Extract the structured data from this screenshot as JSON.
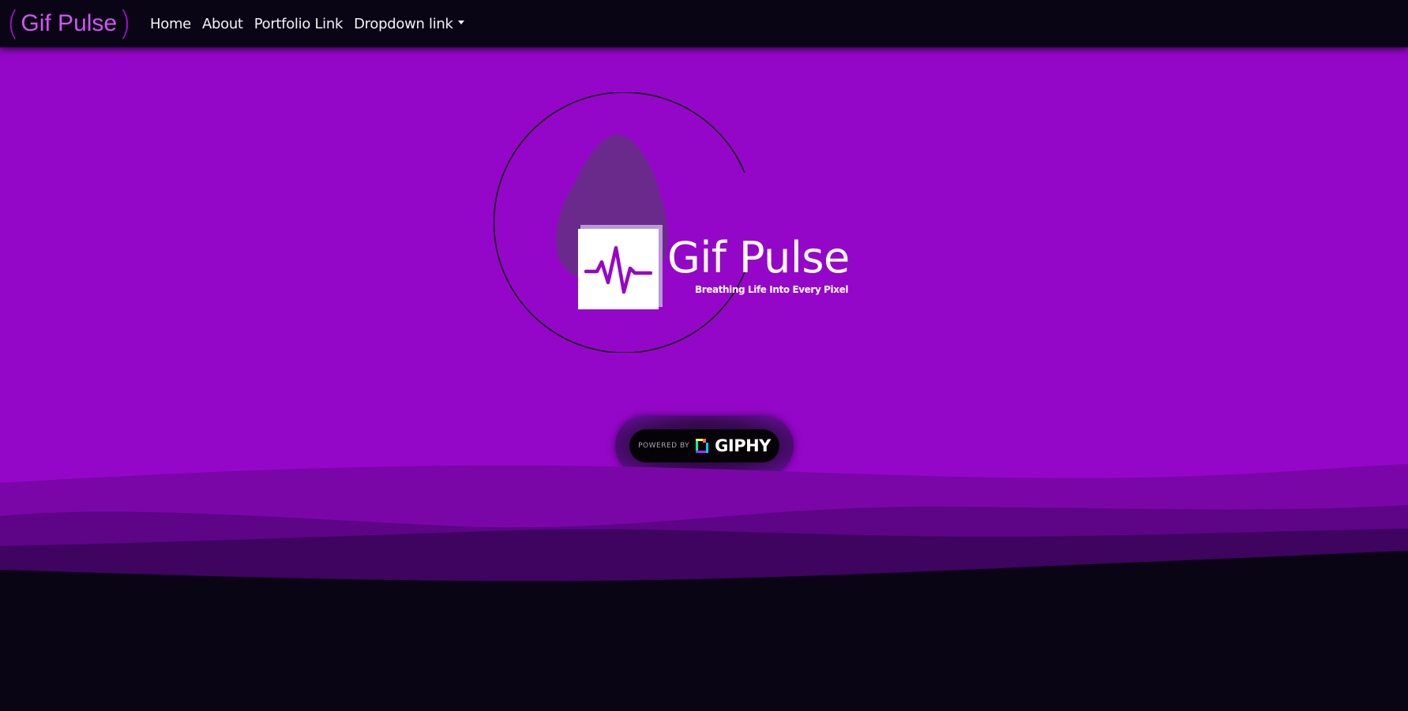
{
  "navbar": {
    "brand": "Gif Pulse",
    "links": [
      "Home",
      "About",
      "Portfolio Link",
      "Dropdown link"
    ]
  },
  "hero": {
    "logo_title": "Gif Pulse",
    "logo_tagline": "Breathing Life Into Every Pixel",
    "giphy_badge": {
      "powered_text": "POWERED BY",
      "brand_text": "GIPHY"
    }
  },
  "colors": {
    "hero_bg": "#9507c8",
    "nav_bg": "#0a0514",
    "brand_accent": "#d056f5",
    "wave_1": "#7a06a8",
    "wave_2": "#5d0487",
    "wave_3": "#3f0360"
  },
  "icons": [
    "pulse-icon",
    "giphy-logo-icon",
    "caret-down-icon"
  ],
  "bottom": {
    "heading": ""
  }
}
